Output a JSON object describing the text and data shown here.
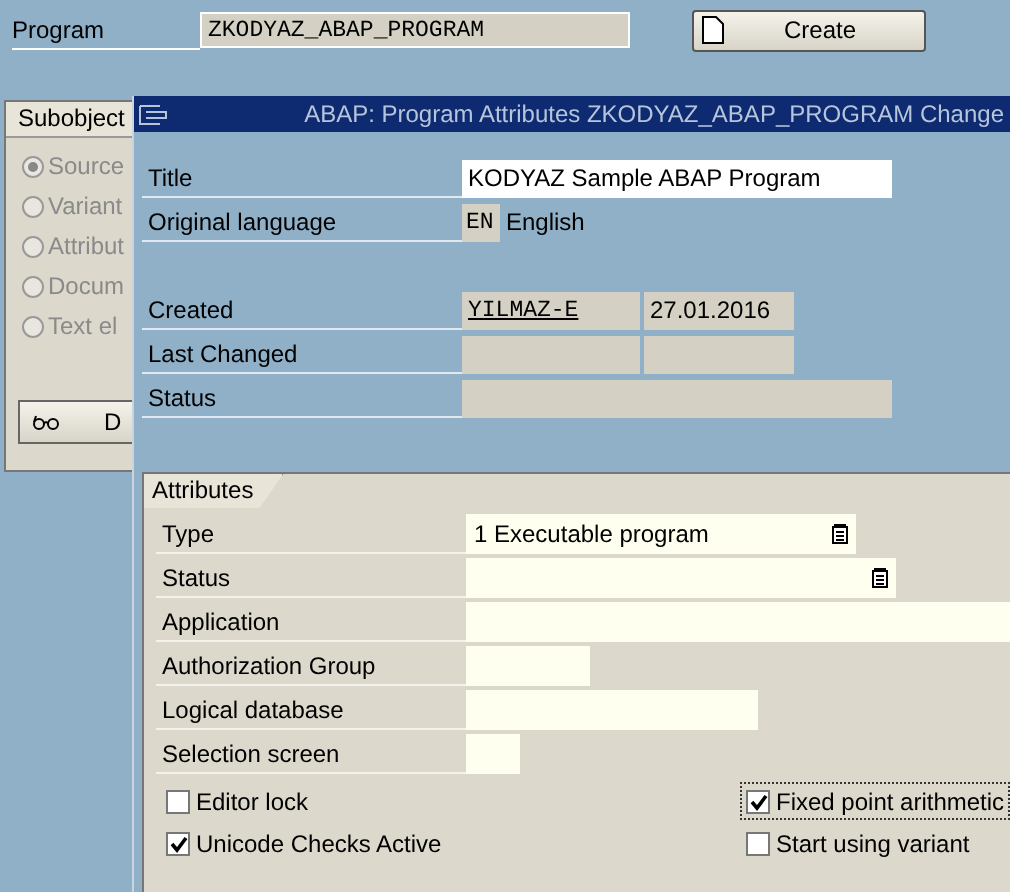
{
  "program": {
    "label": "Program",
    "value": "ZKODYAZ_ABAP_PROGRAM"
  },
  "create_button": {
    "label": "Create"
  },
  "subobjects": {
    "title": "Subobject",
    "options": [
      {
        "label": "Source",
        "selected": true
      },
      {
        "label": "Variant",
        "selected": false
      },
      {
        "label": "Attribut",
        "selected": false
      },
      {
        "label": "Docum",
        "selected": false
      },
      {
        "label": "Text el",
        "selected": false
      }
    ],
    "button": {
      "label": "D"
    }
  },
  "dialog": {
    "title": "ABAP: Program Attributes ZKODYAZ_ABAP_PROGRAM Change",
    "title_field": {
      "label": "Title",
      "value": "KODYAZ Sample ABAP Program"
    },
    "language": {
      "label": "Original language",
      "code": "EN",
      "name": "English"
    },
    "created": {
      "label": "Created",
      "user": "YILMAZ-E",
      "date": "27.01.2016"
    },
    "last_changed": {
      "label": "Last Changed"
    },
    "status": {
      "label": "Status"
    },
    "attributes": {
      "tab": "Attributes",
      "rows": [
        {
          "label": "Type",
          "value": "1 Executable program",
          "kind": "dropdown"
        },
        {
          "label": "Status",
          "kind": "dropdown"
        },
        {
          "label": "Application",
          "kind": "input"
        },
        {
          "label": "Authorization Group",
          "kind": "input"
        },
        {
          "label": "Logical database",
          "kind": "input"
        },
        {
          "label": "Selection screen",
          "kind": "input"
        }
      ],
      "checkboxes": [
        {
          "label": "Editor lock",
          "checked": false,
          "focused": false
        },
        {
          "label": "Fixed point arithmetic",
          "checked": true,
          "focused": true
        },
        {
          "label": "Unicode Checks Active",
          "checked": true,
          "focused": false
        },
        {
          "label": "Start using variant",
          "checked": false,
          "focused": false
        }
      ]
    }
  }
}
